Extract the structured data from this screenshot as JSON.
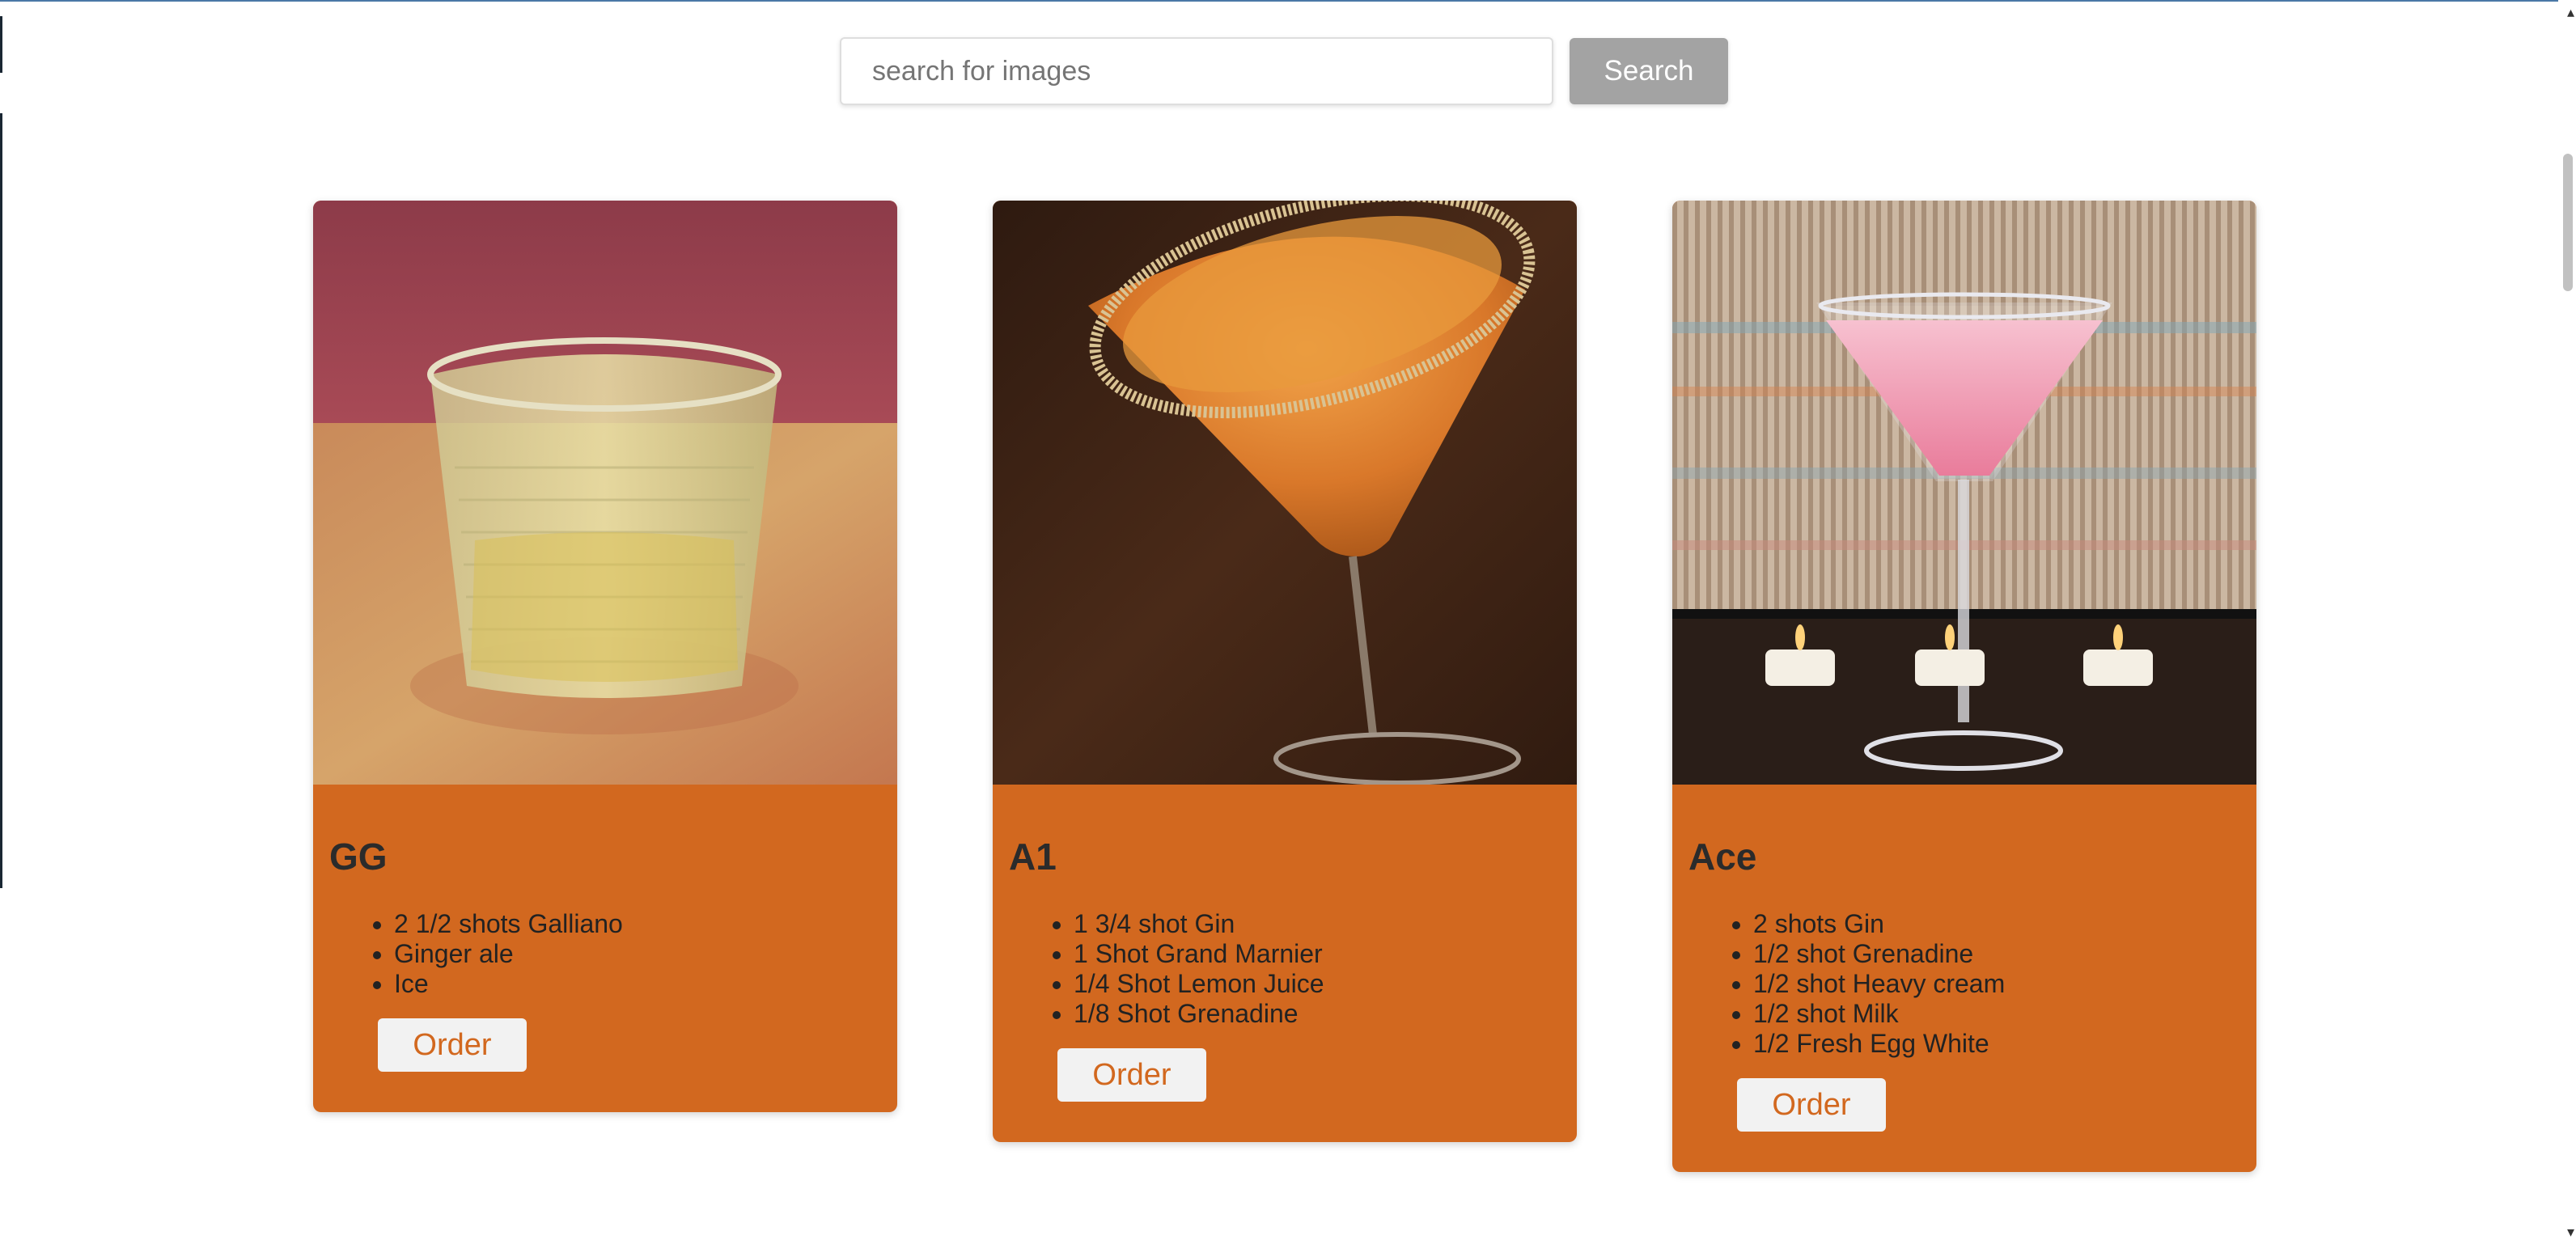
{
  "search": {
    "placeholder": "search for images",
    "button_label": "Search"
  },
  "colors": {
    "card_background": "#d2681f",
    "search_button": "#a3a3a3",
    "order_button_text": "#d2681f"
  },
  "cards": [
    {
      "title": "GG",
      "image_icon": "cocktail-glass-image",
      "ingredients": [
        "2 1/2 shots Galliano",
        "Ginger ale",
        "Ice"
      ],
      "order_label": "Order"
    },
    {
      "title": "A1",
      "image_icon": "cocktail-glass-image",
      "ingredients": [
        "1 3/4 shot Gin",
        "1 Shot Grand Marnier",
        "1/4 Shot Lemon Juice",
        "1/8 Shot Grenadine"
      ],
      "order_label": "Order"
    },
    {
      "title": "Ace",
      "image_icon": "cocktail-glass-image",
      "ingredients": [
        "2 shots Gin",
        "1/2 shot Grenadine",
        "1/2 shot Heavy cream",
        "1/2 shot Milk",
        "1/2 Fresh Egg White"
      ],
      "order_label": "Order"
    }
  ]
}
